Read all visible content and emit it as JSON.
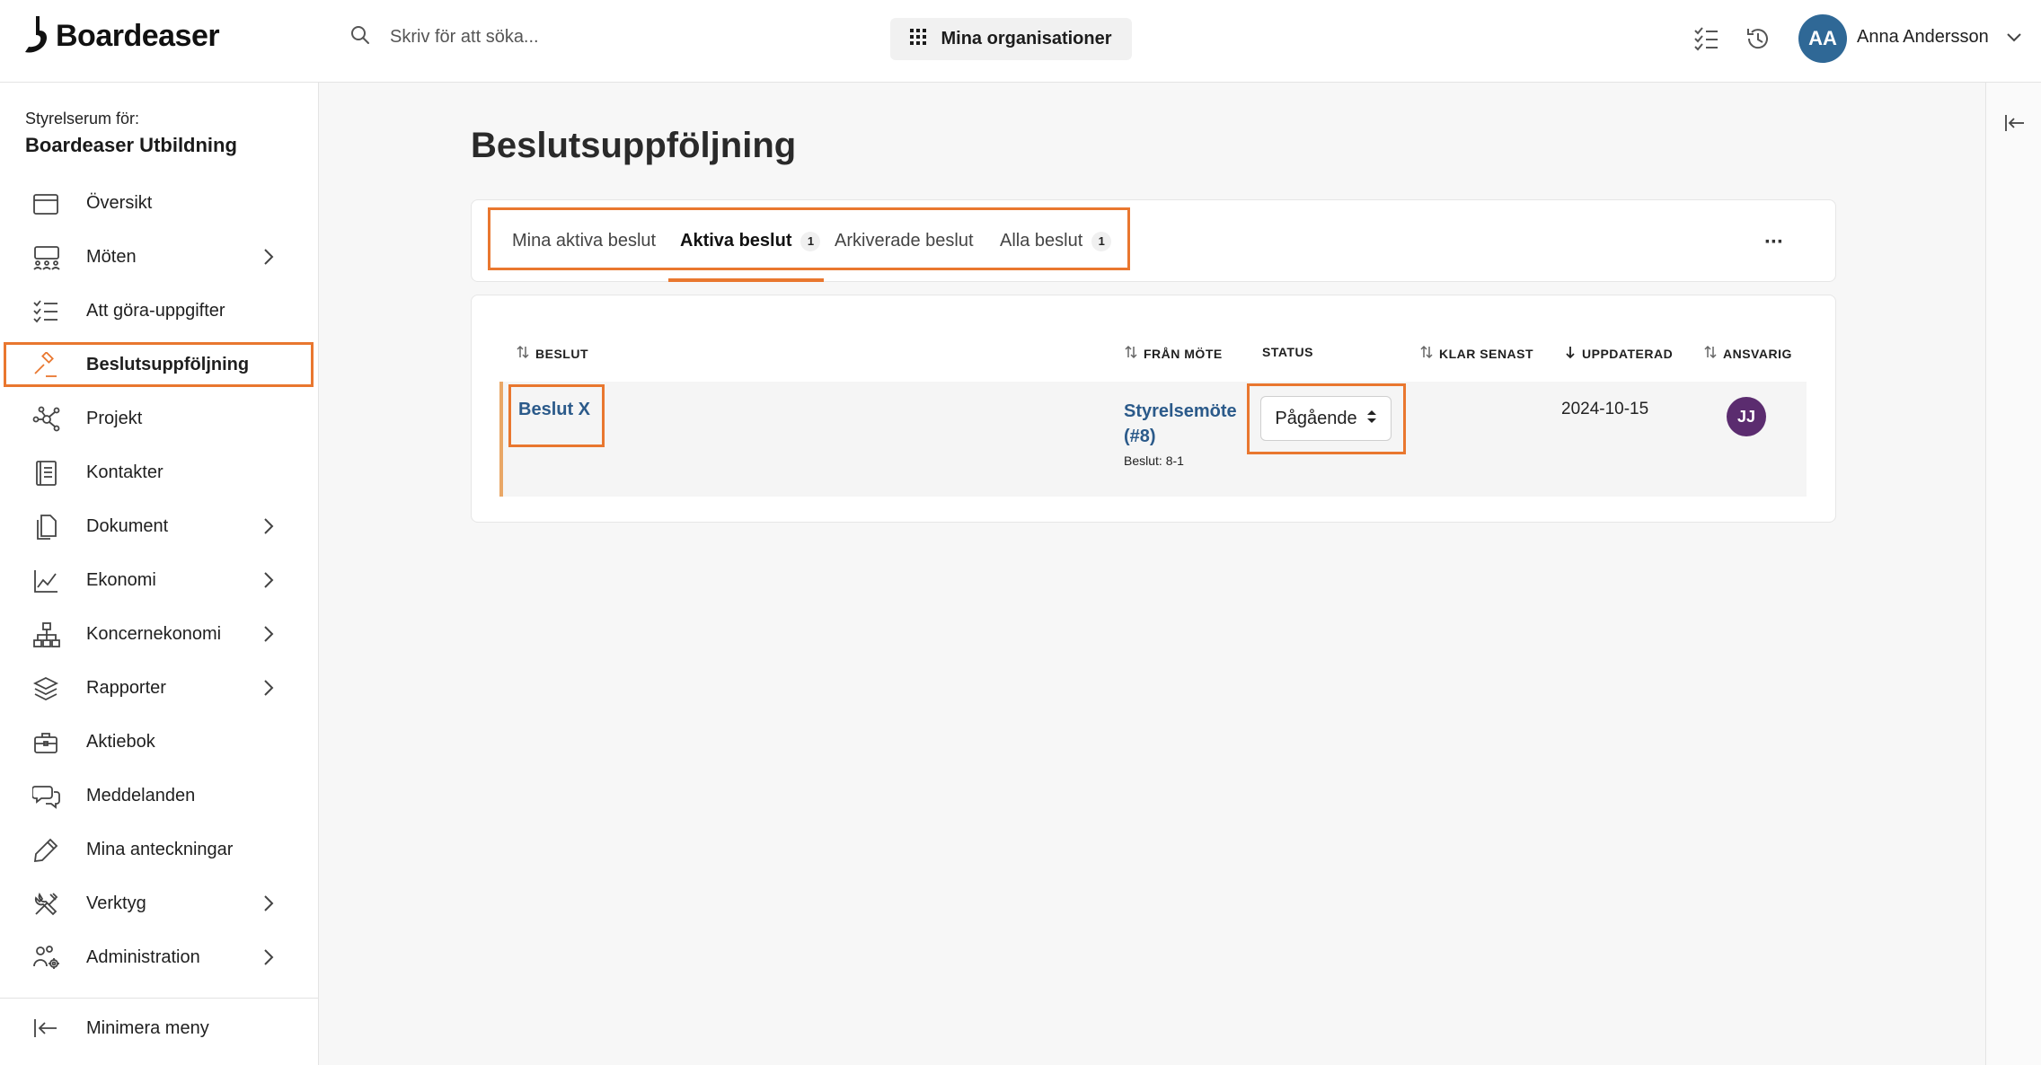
{
  "header": {
    "logo_text": "Boardeaser",
    "search_placeholder": "Skriv för att söka...",
    "orgs_button": "Mina organisationer",
    "user": {
      "initials": "AA",
      "name": "Anna Andersson"
    },
    "icons": [
      "search-icon",
      "grid-icon",
      "checklist-icon",
      "history-icon",
      "chevron-down-icon"
    ]
  },
  "sidebar": {
    "room_label": "Styrelserum för:",
    "room_name": "Boardeaser Utbildning",
    "items": [
      {
        "label": "Översikt",
        "icon": "calendar-icon",
        "has_chevron": false
      },
      {
        "label": "Möten",
        "icon": "meeting-icon",
        "has_chevron": true
      },
      {
        "label": "Att göra-uppgifter",
        "icon": "checklist-icon",
        "has_chevron": false
      },
      {
        "label": "Beslutsuppföljning",
        "icon": "gavel-icon",
        "has_chevron": false,
        "active": true
      },
      {
        "label": "Projekt",
        "icon": "network-icon",
        "has_chevron": false
      },
      {
        "label": "Kontakter",
        "icon": "contacts-book-icon",
        "has_chevron": false
      },
      {
        "label": "Dokument",
        "icon": "documents-icon",
        "has_chevron": true
      },
      {
        "label": "Ekonomi",
        "icon": "line-chart-icon",
        "has_chevron": true
      },
      {
        "label": "Koncernekonomi",
        "icon": "org-tree-icon",
        "has_chevron": true
      },
      {
        "label": "Rapporter",
        "icon": "layers-icon",
        "has_chevron": true
      },
      {
        "label": "Aktiebok",
        "icon": "briefcase-icon",
        "has_chevron": false
      },
      {
        "label": "Meddelanden",
        "icon": "chat-icon",
        "has_chevron": false
      },
      {
        "label": "Mina anteckningar",
        "icon": "pencil-icon",
        "has_chevron": false
      },
      {
        "label": "Verktyg",
        "icon": "tools-icon",
        "has_chevron": true
      },
      {
        "label": "Administration",
        "icon": "users-gear-icon",
        "has_chevron": true
      }
    ],
    "minimize_label": "Minimera meny"
  },
  "main": {
    "title": "Beslutsuppföljning",
    "tabs": [
      {
        "label": "Mina aktiva beslut",
        "count": ""
      },
      {
        "label": "Aktiva beslut",
        "count": "1",
        "active": true
      },
      {
        "label": "Arkiverade beslut",
        "count": ""
      },
      {
        "label": "Alla beslut",
        "count": "1"
      }
    ],
    "more_label": "···",
    "table": {
      "columns": [
        "BESLUT",
        "FRÅN MÖTE",
        "STATUS",
        "KLAR SENAST",
        "UPPDATERAD",
        "ANSVARIG"
      ],
      "rows": [
        {
          "beslut": "Beslut X",
          "fran_mote": "Styrelsemöte (#8)",
          "fran_mote_sub": "Beslut: 8-1",
          "status": "Pågående",
          "klar_senast": "",
          "uppdaterad": "2024-10-15",
          "ansvarig_initials": "JJ"
        }
      ]
    }
  },
  "colors": {
    "accent": "#e9772f",
    "link": "#2b5a8a",
    "avatar_user": "#2f6896",
    "avatar_jj": "#5b2c6f"
  }
}
